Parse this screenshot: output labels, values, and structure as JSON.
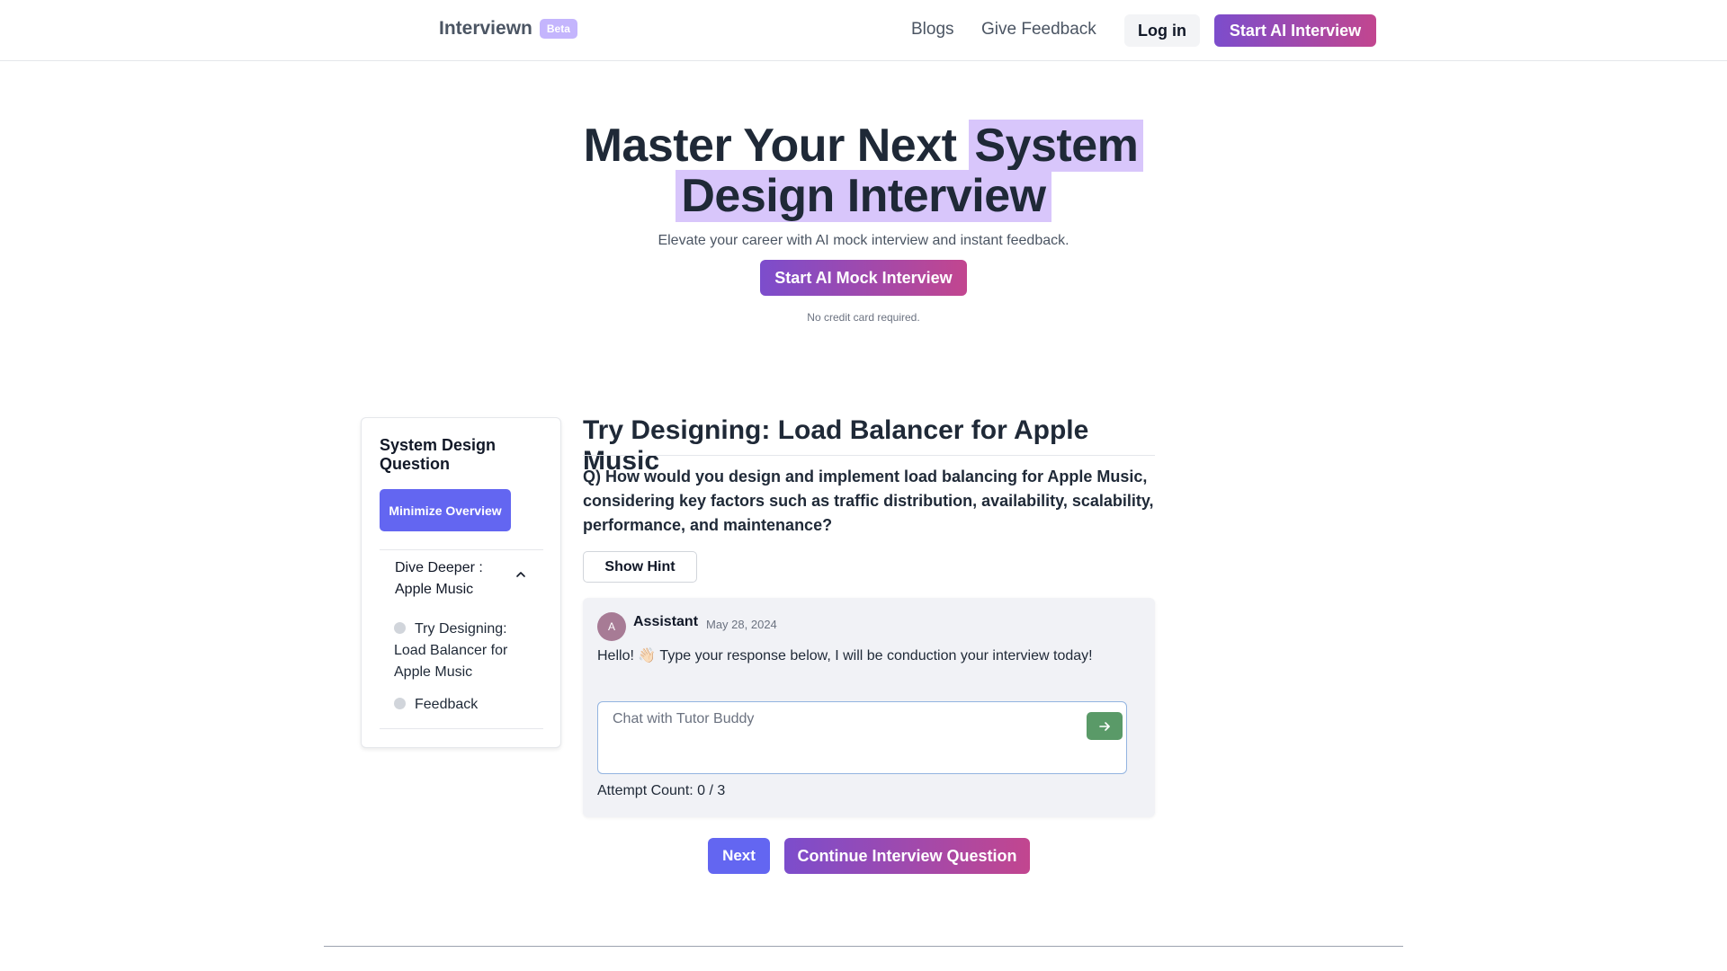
{
  "header": {
    "brand": "Interviewn",
    "badge": "Beta",
    "nav": {
      "blogs": "Blogs",
      "feedback": "Give Feedback"
    },
    "login": "Log in",
    "start_button": "Start AI Interview"
  },
  "hero": {
    "title_plain": "Master Your Next ",
    "title_highlight_1": "System",
    "title_highlight_2": "Design Interview",
    "subtitle": "Elevate your career with AI mock interview and instant feedback.",
    "cta": "Start AI Mock Interview",
    "note": "No credit card required."
  },
  "sidebar": {
    "title": "System Design Question",
    "minimize_button": "Minimize Overview",
    "section": "Dive Deeper : Apple Music",
    "items": [
      {
        "label": "Try Designing: Load Balancer for Apple Music"
      },
      {
        "label": "Feedback"
      }
    ]
  },
  "question": {
    "title": "Try Designing: Load Balancer for Apple Music",
    "text": "Q) How would you design and implement load balancing for Apple Music, considering key factors such as traffic distribution, availability, scalability, performance, and maintenance?",
    "hint_button": "Show Hint"
  },
  "chat": {
    "avatar_initial": "A",
    "sender": "Assistant",
    "date": "May 28, 2024",
    "message": "Hello! 👋🏻 Type your response below, I will be conduction your interview today!",
    "input_placeholder": "Chat with Tutor Buddy",
    "attempt_label": "Attempt Count: 0 / 3"
  },
  "actions": {
    "next": "Next",
    "continue": "Continue Interview Question"
  },
  "colors": {
    "primary_gradient_start": "#7c4dcc",
    "primary_gradient_end": "#c2468f",
    "indigo": "#6366f1",
    "highlight": "#d8c6fb",
    "send_button": "#5a9a68"
  }
}
